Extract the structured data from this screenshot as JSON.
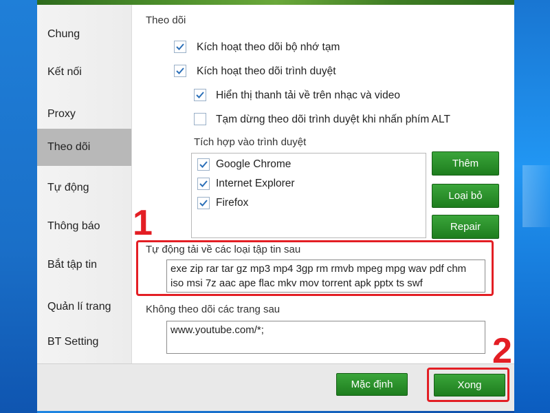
{
  "sidebar": {
    "items": [
      {
        "label": "Chung",
        "active": false
      },
      {
        "label": "Kết nối",
        "active": false
      },
      {
        "label": "Proxy",
        "active": false
      },
      {
        "label": "Theo dõi",
        "active": true
      },
      {
        "label": "Tự động",
        "active": false
      },
      {
        "label": "Thông báo",
        "active": false
      },
      {
        "label": "Bắt tập tin",
        "active": false
      },
      {
        "label": "Quản lí trang",
        "active": false
      },
      {
        "label": "BT Setting",
        "active": false
      }
    ]
  },
  "content": {
    "section_title": "Theo dõi",
    "options": [
      {
        "label": "Kích hoạt theo dõi bộ nhớ tạm",
        "checked": true
      },
      {
        "label": "Kích hoạt theo dõi trình duyệt",
        "checked": true
      },
      {
        "label": "Hiển thị thanh tải về trên nhạc và video",
        "checked": true
      },
      {
        "label": "Tạm dừng theo dõi trình duyệt khi nhấn phím ALT",
        "checked": false
      }
    ],
    "browser_integration_label": "Tích hợp vào trình duyệt",
    "browsers": [
      {
        "label": "Google Chrome",
        "checked": true
      },
      {
        "label": "Internet Explorer",
        "checked": true
      },
      {
        "label": "Firefox",
        "checked": true
      }
    ],
    "buttons": {
      "add": "Thêm",
      "remove": "Loại bỏ",
      "repair": "Repair"
    },
    "auto_download_label": "Tự động tải về các loại tập tin sau",
    "auto_download_value": "exe zip rar tar gz mp3 mp4 3gp rm rmvb mpeg mpg wav pdf chm iso msi 7z aac ape flac mkv mov torrent apk pptx ts swf",
    "no_monitor_label": "Không theo dõi các trang sau",
    "no_monitor_value": "www.youtube.com/*;"
  },
  "footer": {
    "default_label": "Mặc định",
    "done_label": "Xong"
  },
  "annotations": {
    "step1": "1",
    "step2": "2"
  },
  "colors": {
    "accent_green": "#2a8f2a",
    "highlight_red": "#e31e24",
    "active_sidebar": "#b8b8b8"
  }
}
